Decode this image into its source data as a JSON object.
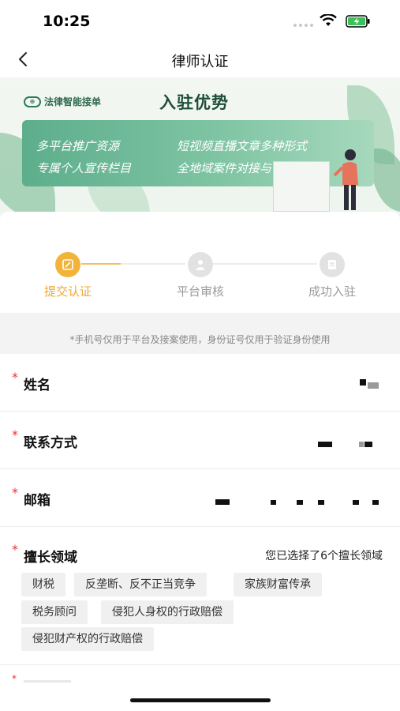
{
  "status_bar": {
    "time": "10:25"
  },
  "nav": {
    "title": "律师认证"
  },
  "banner": {
    "logo_text": "法律智能接单",
    "heading": "入驻优势",
    "lines": [
      "多平台推广资源",
      "短视频直播文章多种形式",
      "专属个人宣传栏目",
      "全地域案件对接与合作"
    ]
  },
  "steps": [
    {
      "label": "提交认证",
      "state": "active"
    },
    {
      "label": "平台审核",
      "state": "pending"
    },
    {
      "label": "成功入驻",
      "state": "pending"
    }
  ],
  "notice": "*手机号仅用于平台及接案使用，身份证号仅用于验证身份使用",
  "form": {
    "required_mark": "*",
    "name_label": "姓名",
    "contact_label": "联系方式",
    "email_label": "邮箱",
    "expertise_label": "擅长领域",
    "expertise_summary": "您已选择了6个擅长领域",
    "tags": [
      "财税",
      "反垄断、反不正当竞争",
      "家族财富传承",
      "税务顾问",
      "侵犯人身权的行政赔偿",
      "侵犯财产权的行政赔偿"
    ]
  },
  "colors": {
    "accent": "#f2b33a",
    "required": "#ee3333",
    "banner_green": "#5dae8b"
  }
}
